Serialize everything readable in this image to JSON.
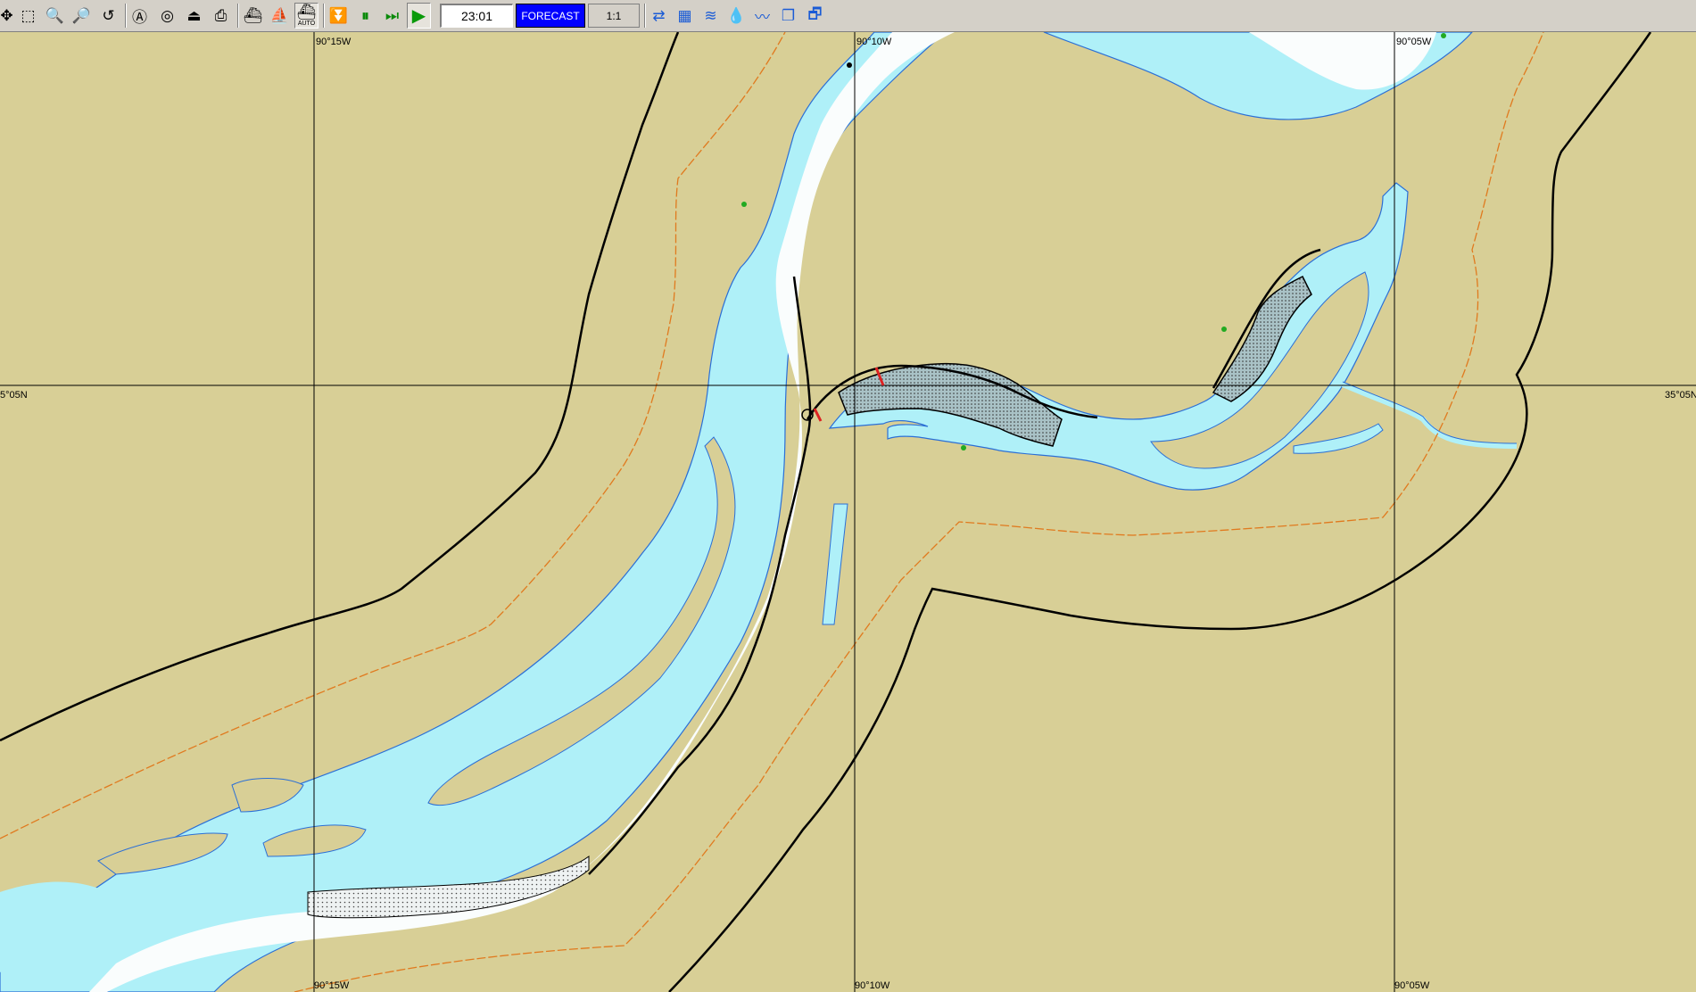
{
  "toolbar": {
    "tools": [
      {
        "icon": "pan-icon"
      },
      {
        "icon": "zoom-window-icon"
      },
      {
        "icon": "zoom-in-icon"
      },
      {
        "icon": "zoom-out-icon"
      },
      {
        "icon": "undo-zoom-icon"
      },
      {
        "icon": "north-arrow-icon"
      },
      {
        "icon": "center-target-icon"
      },
      {
        "icon": "export-icon"
      },
      {
        "icon": "print-icon"
      },
      {
        "icon": "ship-icon"
      },
      {
        "icon": "ship-small-icon"
      },
      {
        "icon": "auto-ship-icon",
        "label": "AUTO"
      },
      {
        "icon": "stop-icon"
      },
      {
        "icon": "pause-icon"
      },
      {
        "icon": "fast-forward-icon"
      },
      {
        "icon": "play-icon"
      }
    ],
    "time": "23:01",
    "mode": "FORECAST",
    "scale": "1:1",
    "layer_tools": [
      {
        "icon": "current-layer-icon"
      },
      {
        "icon": "grid-layer-icon"
      },
      {
        "icon": "wind-layer-icon"
      },
      {
        "icon": "water-layer-icon"
      },
      {
        "icon": "tide-layer-icon"
      },
      {
        "icon": "copy-layer-icon"
      },
      {
        "icon": "window-layer-icon"
      }
    ]
  },
  "map": {
    "longitude_labels": {
      "top": [
        "90°15W",
        "90°10W",
        "90°05W"
      ],
      "bottom": [
        "90°15W",
        "90°10W",
        "90°05W"
      ]
    },
    "latitude_labels": {
      "left": "5°05N",
      "right": "35°05N"
    },
    "colors": {
      "land": "#d8cf96",
      "shallow_water": "#aff0f8",
      "deep_water": "#fafdfd",
      "levee": "#000000",
      "boundary": "#e07a1f",
      "marker": "#22aa22"
    }
  }
}
